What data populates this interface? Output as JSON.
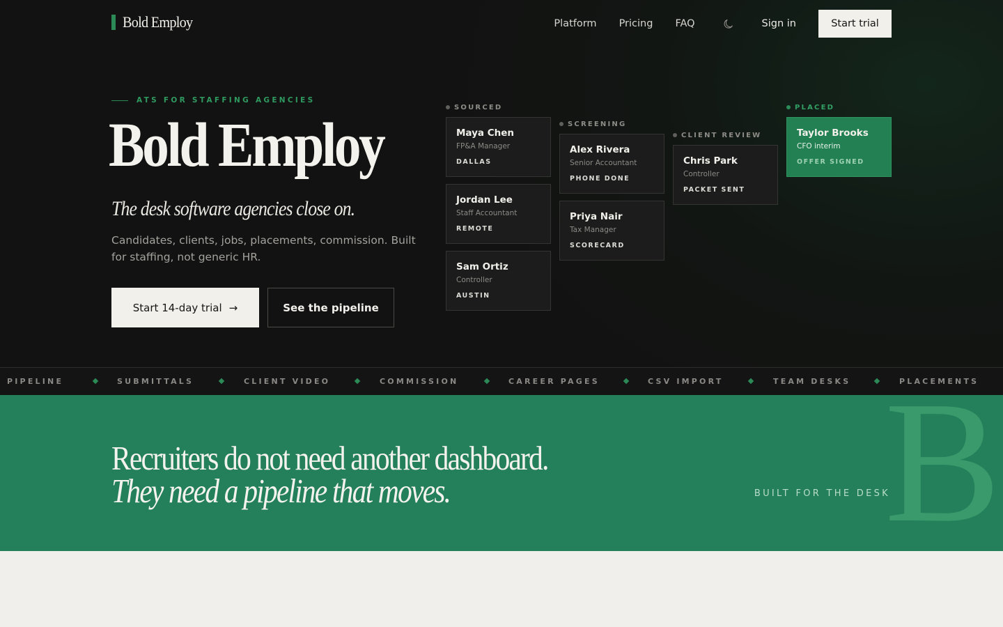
{
  "brand": {
    "name": "Bold Employ",
    "accent": "#2c8a57"
  },
  "nav": {
    "links": [
      "Platform",
      "Pricing",
      "FAQ"
    ],
    "theme_icon": "moon-icon",
    "sign_in": "Sign in",
    "cta": "Start trial"
  },
  "hero": {
    "eyebrow": "ATS FOR STAFFING AGENCIES",
    "title": "Bold Employ",
    "tagline": "The desk software agencies close on.",
    "description": "Candidates, clients, jobs, placements, commission. Built for staffing, not generic HR.",
    "primary_cta": "Start 14-day trial",
    "primary_cta_arrow": "→",
    "secondary_cta": "See the pipeline"
  },
  "pipeline": {
    "columns": [
      {
        "label": "SOURCED",
        "cards": [
          {
            "name": "Maya Chen",
            "role": "FP&A Manager",
            "tag": "DALLAS"
          },
          {
            "name": "Jordan Lee",
            "role": "Staff Accountant",
            "tag": "REMOTE"
          },
          {
            "name": "Sam Ortiz",
            "role": "Controller",
            "tag": "AUSTIN"
          }
        ]
      },
      {
        "label": "SCREENING",
        "cards": [
          {
            "name": "Alex Rivera",
            "role": "Senior Accountant",
            "tag": "PHONE DONE"
          },
          {
            "name": "Priya Nair",
            "role": "Tax Manager",
            "tag": "SCORECARD"
          }
        ]
      },
      {
        "label": "CLIENT REVIEW",
        "cards": [
          {
            "name": "Chris Park",
            "role": "Controller",
            "tag": "PACKET SENT"
          }
        ]
      },
      {
        "label": "PLACED",
        "cards": [
          {
            "name": "Taylor Brooks",
            "role": "CFO interim",
            "tag": "OFFER SIGNED"
          }
        ]
      }
    ]
  },
  "ticker": [
    "PIPELINE",
    "SUBMITTALS",
    "CLIENT VIDEO",
    "COMMISSION",
    "CAREER PAGES",
    "CSV IMPORT",
    "TEAM DESKS",
    "PLACEMENTS"
  ],
  "band": {
    "headline": "Recruiters do not need another dashboard.",
    "headline_italic": "They need a pipeline that moves.",
    "label": "BUILT FOR THE DESK",
    "watermark": "BE"
  }
}
